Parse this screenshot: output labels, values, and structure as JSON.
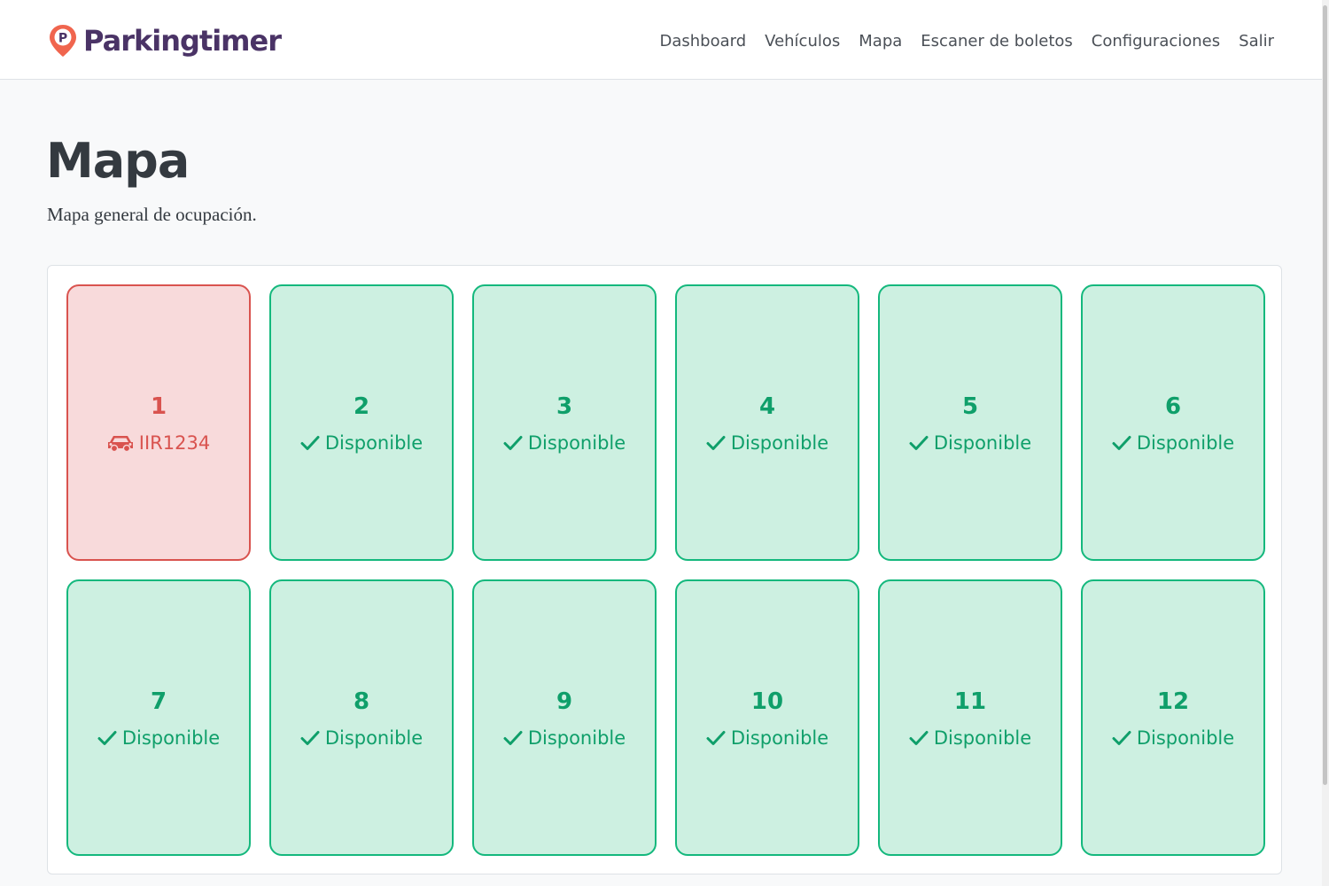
{
  "brand": {
    "name": "Parkingtimer",
    "logo_letter": "P",
    "logo_color": "#f0654e",
    "text_color": "#4a3366"
  },
  "nav": {
    "items": [
      {
        "label": "Dashboard",
        "name": "nav-dashboard"
      },
      {
        "label": "Vehículos",
        "name": "nav-vehiculos"
      },
      {
        "label": "Mapa",
        "name": "nav-mapa"
      },
      {
        "label": "Escaner de boletos",
        "name": "nav-escaner-boletos"
      },
      {
        "label": "Configuraciones",
        "name": "nav-configuraciones"
      },
      {
        "label": "Salir",
        "name": "nav-salir"
      }
    ]
  },
  "page": {
    "title": "Mapa",
    "subtitle": "Mapa general de ocupación."
  },
  "colors": {
    "available_border": "#14b87d",
    "available_bg": "#cdf0e1",
    "available_text": "#0f9f6a",
    "occupied_border": "#d9534f",
    "occupied_bg": "#f8dadb",
    "occupied_text": "#d9534f"
  },
  "spots": [
    {
      "number": "1",
      "occupied": true,
      "icon": "car-icon",
      "status": "IIR1234"
    },
    {
      "number": "2",
      "occupied": false,
      "icon": "check-icon",
      "status": "Disponible"
    },
    {
      "number": "3",
      "occupied": false,
      "icon": "check-icon",
      "status": "Disponible"
    },
    {
      "number": "4",
      "occupied": false,
      "icon": "check-icon",
      "status": "Disponible"
    },
    {
      "number": "5",
      "occupied": false,
      "icon": "check-icon",
      "status": "Disponible"
    },
    {
      "number": "6",
      "occupied": false,
      "icon": "check-icon",
      "status": "Disponible"
    },
    {
      "number": "7",
      "occupied": false,
      "icon": "check-icon",
      "status": "Disponible"
    },
    {
      "number": "8",
      "occupied": false,
      "icon": "check-icon",
      "status": "Disponible"
    },
    {
      "number": "9",
      "occupied": false,
      "icon": "check-icon",
      "status": "Disponible"
    },
    {
      "number": "10",
      "occupied": false,
      "icon": "check-icon",
      "status": "Disponible"
    },
    {
      "number": "11",
      "occupied": false,
      "icon": "check-icon",
      "status": "Disponible"
    },
    {
      "number": "12",
      "occupied": false,
      "icon": "check-icon",
      "status": "Disponible"
    }
  ]
}
